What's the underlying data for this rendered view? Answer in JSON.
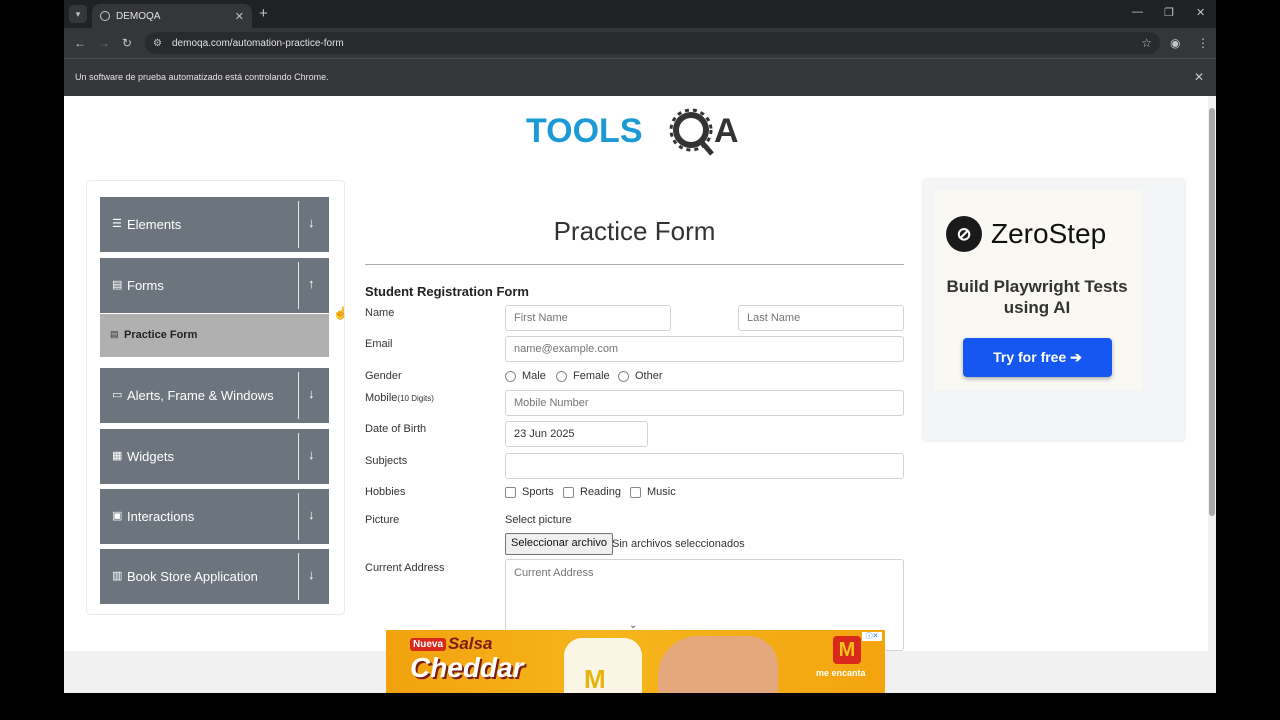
{
  "browser": {
    "tab_title": "DEMOQA",
    "url": "demoqa.com/automation-practice-form",
    "infobar_message": "Un software de prueba automatizado está controlando Chrome.",
    "icons": [
      "down-caret-icon",
      "globe-icon",
      "close-icon",
      "plus-icon",
      "minimize-icon",
      "restore-icon",
      "back-icon",
      "forward-icon",
      "reload-icon",
      "tune-icon",
      "star-icon",
      "profile-icon",
      "kebab-icon"
    ]
  },
  "logo": {
    "text_left": "TOOLS",
    "text_right": "A"
  },
  "sidebar": {
    "groups": [
      {
        "label": "Elements",
        "icon": "hamburger-icon",
        "toggle": "↓"
      },
      {
        "label": "Forms",
        "icon": "document-icon",
        "toggle": "↑"
      },
      {
        "label": "Alerts, Frame & Windows",
        "icon": "window-icon",
        "toggle": "↓"
      },
      {
        "label": "Widgets",
        "icon": "grid-icon",
        "toggle": "↓"
      },
      {
        "label": "Interactions",
        "icon": "square-icon",
        "toggle": "↓"
      },
      {
        "label": "Book Store Application",
        "icon": "books-icon",
        "toggle": "↓"
      }
    ],
    "active_item": "Practice Form"
  },
  "form": {
    "title": "Practice Form",
    "subtitle": "Student Registration Form",
    "labels": {
      "name": "Name",
      "email": "Email",
      "gender": "Gender",
      "mobile": "Mobile",
      "mobile_hint": "(10 Digits)",
      "dob": "Date of Birth",
      "subjects": "Subjects",
      "hobbies": "Hobbies",
      "picture": "Picture",
      "address": "Current Address"
    },
    "placeholders": {
      "first_name": "First Name",
      "last_name": "Last Name",
      "email": "name@example.com",
      "mobile": "Mobile Number",
      "address": "Current Address"
    },
    "dob_value": "23 Jun 2025",
    "genders": [
      "Male",
      "Female",
      "Other"
    ],
    "hobbies": [
      "Sports",
      "Reading",
      "Music"
    ],
    "picture_label": "Select picture",
    "file_button": "Seleccionar archivo",
    "file_status": "Sin archivos seleccionados"
  },
  "ad_right": {
    "brand": "ZeroStep",
    "tagline": "Build Playwright Tests using AI",
    "cta": "Try for free ➔"
  },
  "ad_bottom": {
    "badge": "Nueva",
    "line1": "Salsa",
    "line2": "Cheddar",
    "slogan": "me encanta",
    "logo": "M"
  }
}
